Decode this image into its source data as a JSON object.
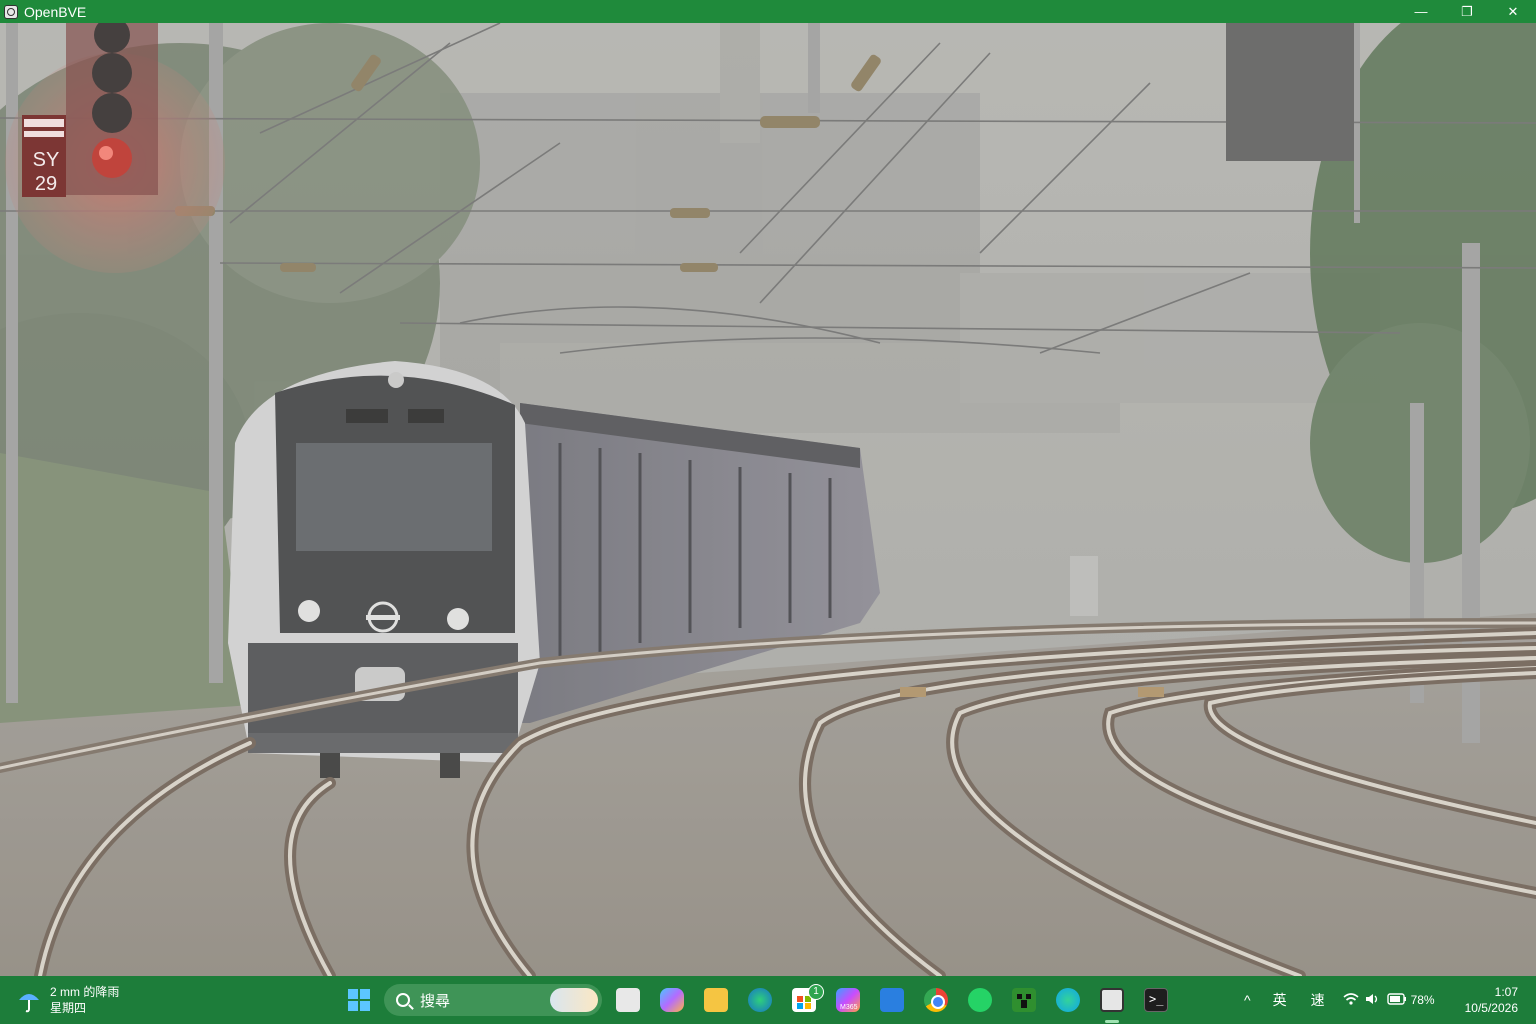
{
  "window": {
    "title": "OpenBVE",
    "minimize_glyph": "—",
    "restore_glyph": "❐",
    "close_glyph": "✕"
  },
  "scene": {
    "signal_plate_line1": "SY",
    "signal_plate_line2": "29",
    "signal_aspect": "red",
    "weather": "fog"
  },
  "taskbar": {
    "weather_line1": "2 mm 的降雨",
    "weather_line2": "星期四",
    "search_placeholder": "搜尋",
    "store_badge": "1",
    "m365_label": "M365",
    "ime_language": "英",
    "ime_mode": "速",
    "battery_percent": "78%",
    "time": "1:07",
    "date": "10/5/2026",
    "chevron": "^",
    "accent_color": "#1d7d3a"
  }
}
